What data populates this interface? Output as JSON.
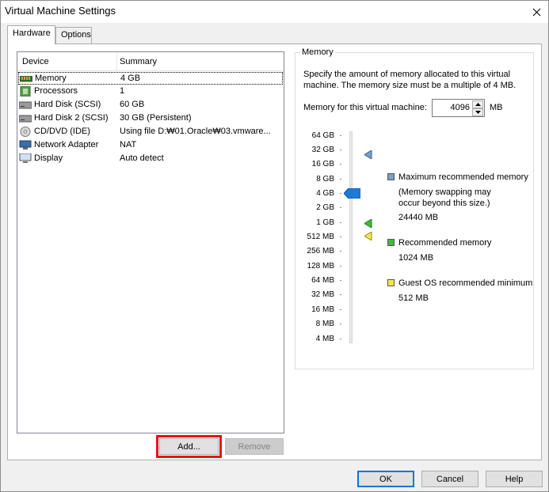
{
  "window": {
    "title": "Virtual Machine Settings"
  },
  "tabs": [
    {
      "label": "Hardware"
    },
    {
      "label": "Options"
    }
  ],
  "device_list": {
    "headers": {
      "device": "Device",
      "summary": "Summary"
    },
    "rows": [
      {
        "icon": "memory-icon",
        "device": "Memory",
        "summary": "4 GB"
      },
      {
        "icon": "processor-icon",
        "device": "Processors",
        "summary": "1"
      },
      {
        "icon": "hard-disk-icon",
        "device": "Hard Disk (SCSI)",
        "summary": "60 GB"
      },
      {
        "icon": "hard-disk-icon",
        "device": "Hard Disk 2 (SCSI)",
        "summary": "30 GB (Persistent)"
      },
      {
        "icon": "cd-dvd-icon",
        "device": "CD/DVD (IDE)",
        "summary": "Using file D:₩01.Oracle₩03.vmware..."
      },
      {
        "icon": "network-adapter-icon",
        "device": "Network Adapter",
        "summary": "NAT"
      },
      {
        "icon": "display-icon",
        "device": "Display",
        "summary": "Auto detect"
      }
    ]
  },
  "buttons": {
    "add": "Add...",
    "remove": "Remove",
    "ok": "OK",
    "cancel": "Cancel",
    "help": "Help"
  },
  "memory": {
    "group_label": "Memory",
    "description": "Specify the amount of memory allocated to this virtual machine. The memory size must be a multiple of 4 MB.",
    "field_label": "Memory for this virtual machine:",
    "value": "4096",
    "unit": "MB",
    "scale": [
      "64 GB",
      "32 GB",
      "16 GB",
      "8 GB",
      "4 GB",
      "2 GB",
      "1 GB",
      "512 MB",
      "256 MB",
      "128 MB",
      "64 MB",
      "32 MB",
      "16 MB",
      "8 MB",
      "4 MB"
    ],
    "current_value": "4 GB",
    "legend": {
      "max": {
        "title": "Maximum recommended memory",
        "note_line1": "(Memory swapping may",
        "note_line2": "occur beyond this size.)",
        "value": "24440 MB",
        "color": "#7d9ec8"
      },
      "recommended": {
        "title": "Recommended memory",
        "value": "1024 MB",
        "color": "#44b844"
      },
      "guest_min": {
        "title": "Guest OS recommended minimum",
        "value": "512 MB",
        "color": "#f2e64a"
      }
    }
  }
}
